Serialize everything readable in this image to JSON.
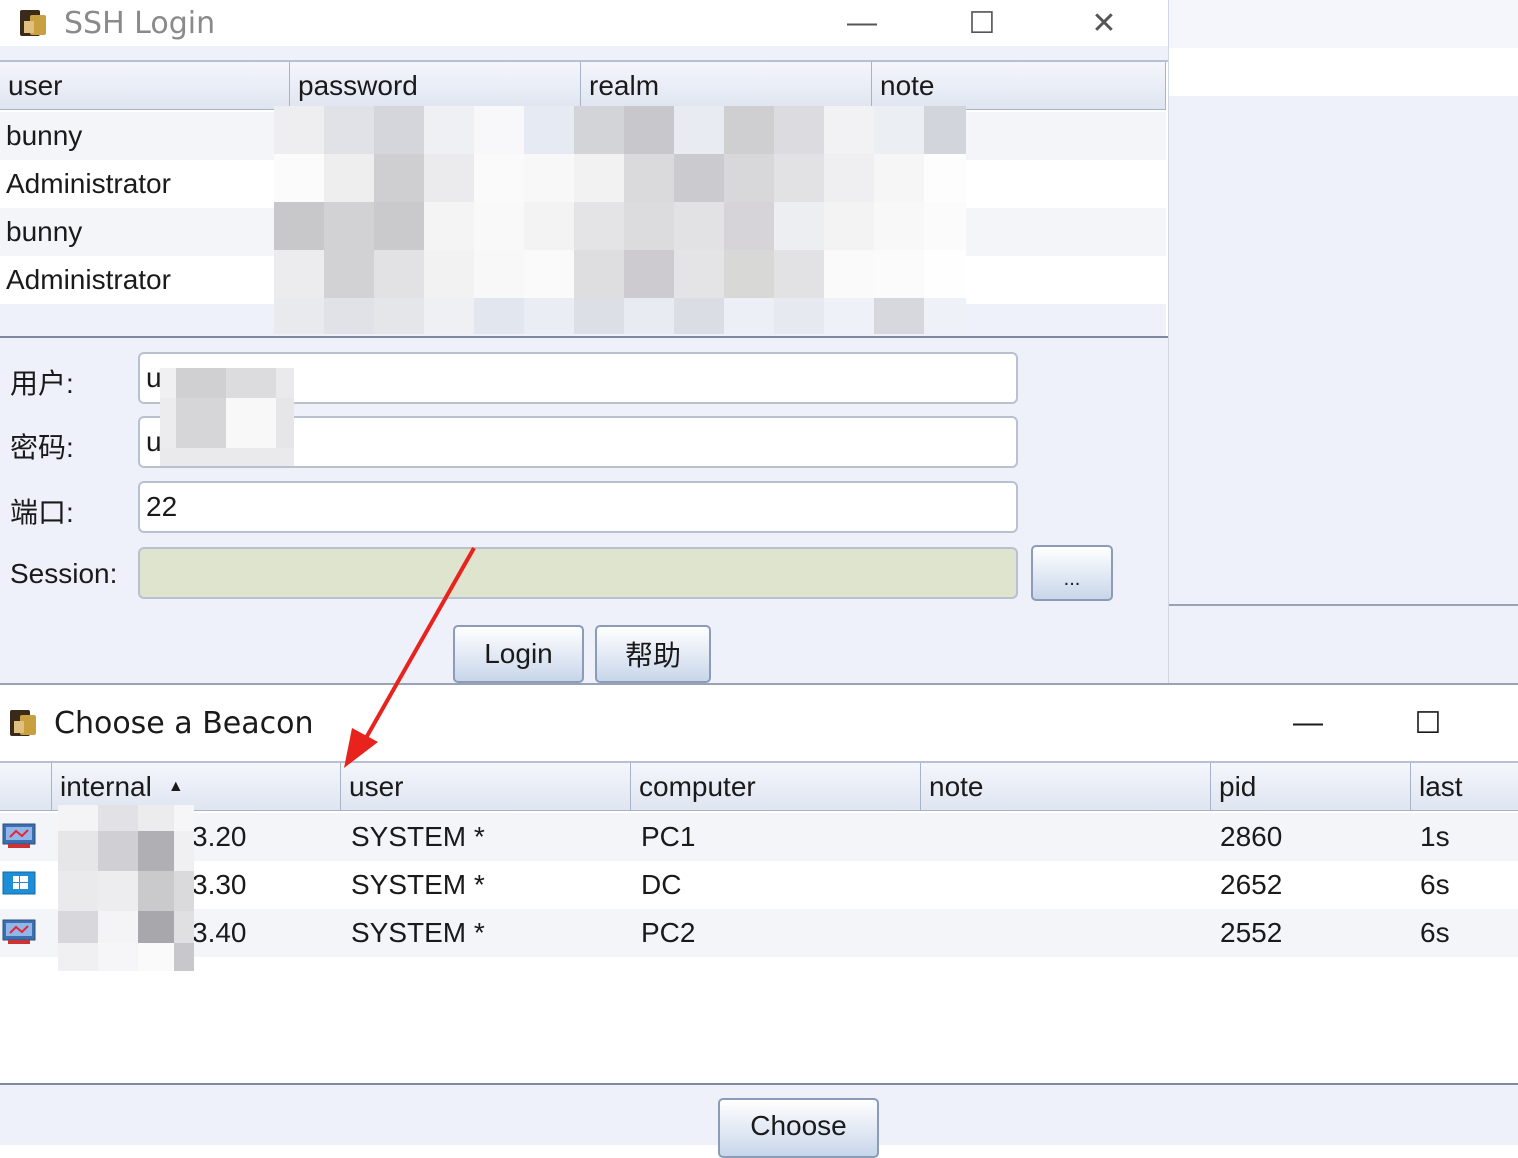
{
  "ssh_window": {
    "title": "SSH Login",
    "controls": {
      "minimize": "—",
      "maximize": "☐",
      "close": "✕"
    },
    "columns": [
      "user",
      "password",
      "realm",
      "note"
    ],
    "rows": [
      {
        "user": "bunny"
      },
      {
        "user": "Administrator"
      },
      {
        "user": "bunny"
      },
      {
        "user": "Administrator"
      }
    ],
    "form": {
      "user_label": "用户:",
      "user_value": "u",
      "password_label": "密码:",
      "password_value": "u",
      "port_label": "端口:",
      "port_value": "22",
      "session_label": "Session:",
      "session_value": "",
      "browse_label": "..."
    },
    "buttons": {
      "login": "Login",
      "help": "帮助"
    }
  },
  "beacon_window": {
    "title": "Choose a Beacon",
    "controls": {
      "minimize": "—",
      "maximize": "☐"
    },
    "columns": [
      "internal",
      "user",
      "computer",
      "note",
      "pid",
      "last"
    ],
    "sort_indicator": "▲",
    "rows": [
      {
        "internal": "3.20",
        "user": "SYSTEM *",
        "computer": "PC1",
        "note": "",
        "pid": "2860",
        "last": "1s",
        "os_icon": "monitor-icon"
      },
      {
        "internal": "3.30",
        "user": "SYSTEM *",
        "computer": "DC",
        "note": "",
        "pid": "2652",
        "last": "6s",
        "os_icon": "windows-icon"
      },
      {
        "internal": "3.40",
        "user": "SYSTEM *",
        "computer": "PC2",
        "note": "",
        "pid": "2552",
        "last": "6s",
        "os_icon": "monitor-icon"
      }
    ],
    "choose_button": "Choose"
  },
  "colors": {
    "annotation_arrow": "#e8231e",
    "window_bg": "#eef1f9",
    "session_field": "#dfe4cf"
  }
}
